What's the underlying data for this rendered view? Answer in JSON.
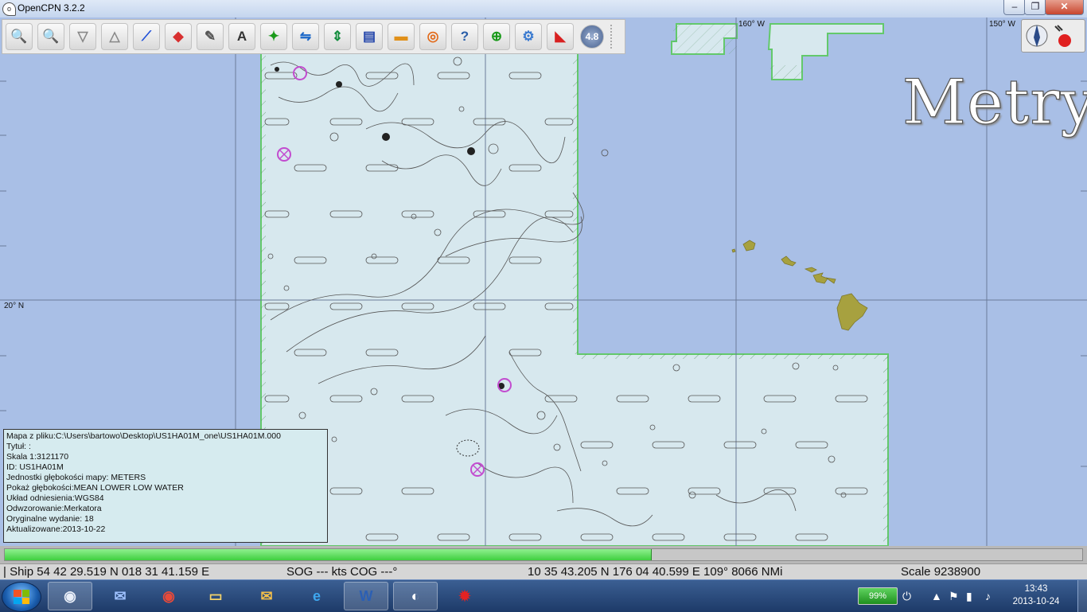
{
  "window": {
    "title": "OpenCPN 3.2.2",
    "min": "–",
    "max": "❐",
    "close": "✕"
  },
  "toolbar": {
    "buttons": [
      {
        "icon": "zoom-in-icon",
        "glyph": "🔍",
        "color": "#2a6fcf"
      },
      {
        "icon": "zoom-out-icon",
        "glyph": "🔍",
        "color": "#2a6fcf"
      },
      {
        "icon": "scale-in-icon",
        "glyph": "▽",
        "color": "#888"
      },
      {
        "icon": "scale-out-icon",
        "glyph": "△",
        "color": "#888"
      },
      {
        "icon": "route-icon",
        "glyph": "⟋",
        "color": "#1f4fd8"
      },
      {
        "icon": "auto-follow-icon",
        "glyph": "◆",
        "color": "#d83030"
      },
      {
        "icon": "settings-icon",
        "glyph": "✎",
        "color": "#555"
      },
      {
        "icon": "text-icon",
        "glyph": "A",
        "color": "#333"
      },
      {
        "icon": "current-icon",
        "glyph": "✦",
        "color": "#1a9a1a"
      },
      {
        "icon": "tide-icon",
        "glyph": "⇋",
        "color": "#1a66c8"
      },
      {
        "icon": "tide-height-icon",
        "glyph": "⇕",
        "color": "#128c3c"
      },
      {
        "icon": "chart-quilt-icon",
        "glyph": "▤",
        "color": "#2244aa"
      },
      {
        "icon": "sunset-icon",
        "glyph": "▬",
        "color": "#e0901a"
      },
      {
        "icon": "life-ring-icon",
        "glyph": "◎",
        "color": "#e26a1a"
      },
      {
        "icon": "help-icon",
        "glyph": "?",
        "color": "#2a5ea8"
      },
      {
        "icon": "target-icon",
        "glyph": "⊕",
        "color": "#1a9a1a"
      },
      {
        "icon": "plugin-icon",
        "glyph": "⚙",
        "color": "#3a7ad0"
      },
      {
        "icon": "mob-icon",
        "glyph": "◣",
        "color": "#d82020"
      }
    ],
    "scale_value": "4.8"
  },
  "map": {
    "grid_labels": {
      "lon1": "160° W",
      "lon2": "150° W",
      "lat1": "20° N"
    },
    "overlay": "Metry"
  },
  "infobox": {
    "lines": [
      "Mapa z pliku:C:\\Users\\bartowo\\Desktop\\US1HA01M_one\\US1HA01M.000",
      "Tytuł: :",
      "Skala 1:3121170",
      "ID:  US1HA01M",
      "Jednostki głębokości mapy: METERS",
      "Pokaż głębokości:MEAN LOWER LOW WATER",
      "Układ odniesienia:WGS84",
      "Odwzorowanie:Merkatora",
      "Oryginalne wydanie:  18",
      "Aktualizowane:2013-10-22"
    ]
  },
  "progress": {
    "value": 0.6
  },
  "status": {
    "ship": "| Ship 54 42 29.519 N   018 31 41.159 E",
    "sog": "SOG --- kts  COG ---°",
    "cursor": "10 35 43.205 N   176 04 40.599 E  109°  8066 NMi",
    "scale": "Scale 9238900"
  },
  "taskbar": {
    "apps": [
      {
        "icon": "capture-app-icon",
        "glyph": "◉",
        "color": "#e8eef8",
        "active": true
      },
      {
        "icon": "thunderbird-icon",
        "glyph": "✉",
        "color": "#9fc2ff",
        "active": false
      },
      {
        "icon": "chrome-icon",
        "glyph": "◉",
        "color": "#e84a3a",
        "active": false
      },
      {
        "icon": "explorer-folder-icon",
        "glyph": "▭",
        "color": "#f4d36a",
        "active": false
      },
      {
        "icon": "outlook-icon",
        "glyph": "✉",
        "color": "#f4c04a",
        "active": false
      },
      {
        "icon": "internet-explorer-icon",
        "glyph": "e",
        "color": "#3ea7ef",
        "active": false
      },
      {
        "icon": "word-icon",
        "glyph": "W",
        "color": "#2b5fb4",
        "active": true
      },
      {
        "icon": "opencpn-icon",
        "glyph": "◐",
        "color": "#ffffff",
        "active": true
      },
      {
        "icon": "paint-splat-icon",
        "glyph": "✹",
        "color": "#e62222",
        "active": false
      }
    ],
    "battery": "99%",
    "time": "13:43",
    "date": "2013-10-24"
  },
  "colors": {
    "water": "#a9bfe6",
    "chart_area": "#d7e8ee",
    "coverage_border": "#63c96b",
    "land": "#a7a13f"
  }
}
